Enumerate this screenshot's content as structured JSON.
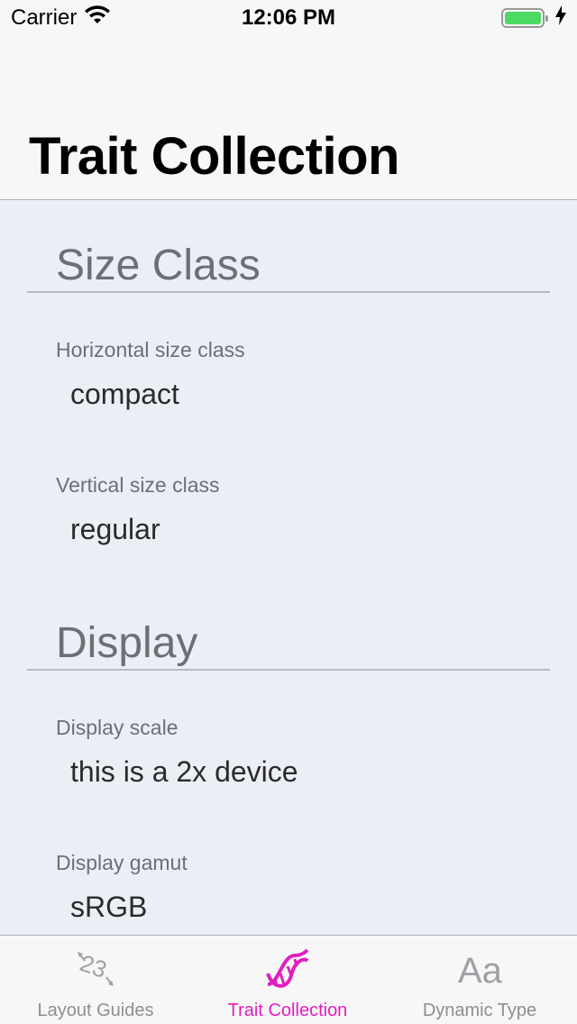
{
  "status_bar": {
    "carrier": "Carrier",
    "time": "12:06 PM"
  },
  "nav": {
    "title": "Trait Collection"
  },
  "sections": [
    {
      "header": "Size Class",
      "fields": [
        {
          "label": "Horizontal size class",
          "value": "compact"
        },
        {
          "label": "Vertical size class",
          "value": "regular"
        }
      ]
    },
    {
      "header": "Display",
      "fields": [
        {
          "label": "Display scale",
          "value": "this is a 2x device"
        },
        {
          "label": "Display gamut",
          "value": "sRGB"
        }
      ]
    }
  ],
  "tab_bar": {
    "tabs": [
      {
        "label": "Layout Guides",
        "icon": "layout-guides-icon",
        "active": false
      },
      {
        "label": "Trait Collection",
        "icon": "dna-icon",
        "active": true
      },
      {
        "label": "Dynamic Type",
        "icon": "font-size-icon",
        "active": false
      }
    ]
  },
  "colors": {
    "accent": "#e01fbe",
    "content_background": "#ebeef5",
    "battery": "#4cd964"
  }
}
